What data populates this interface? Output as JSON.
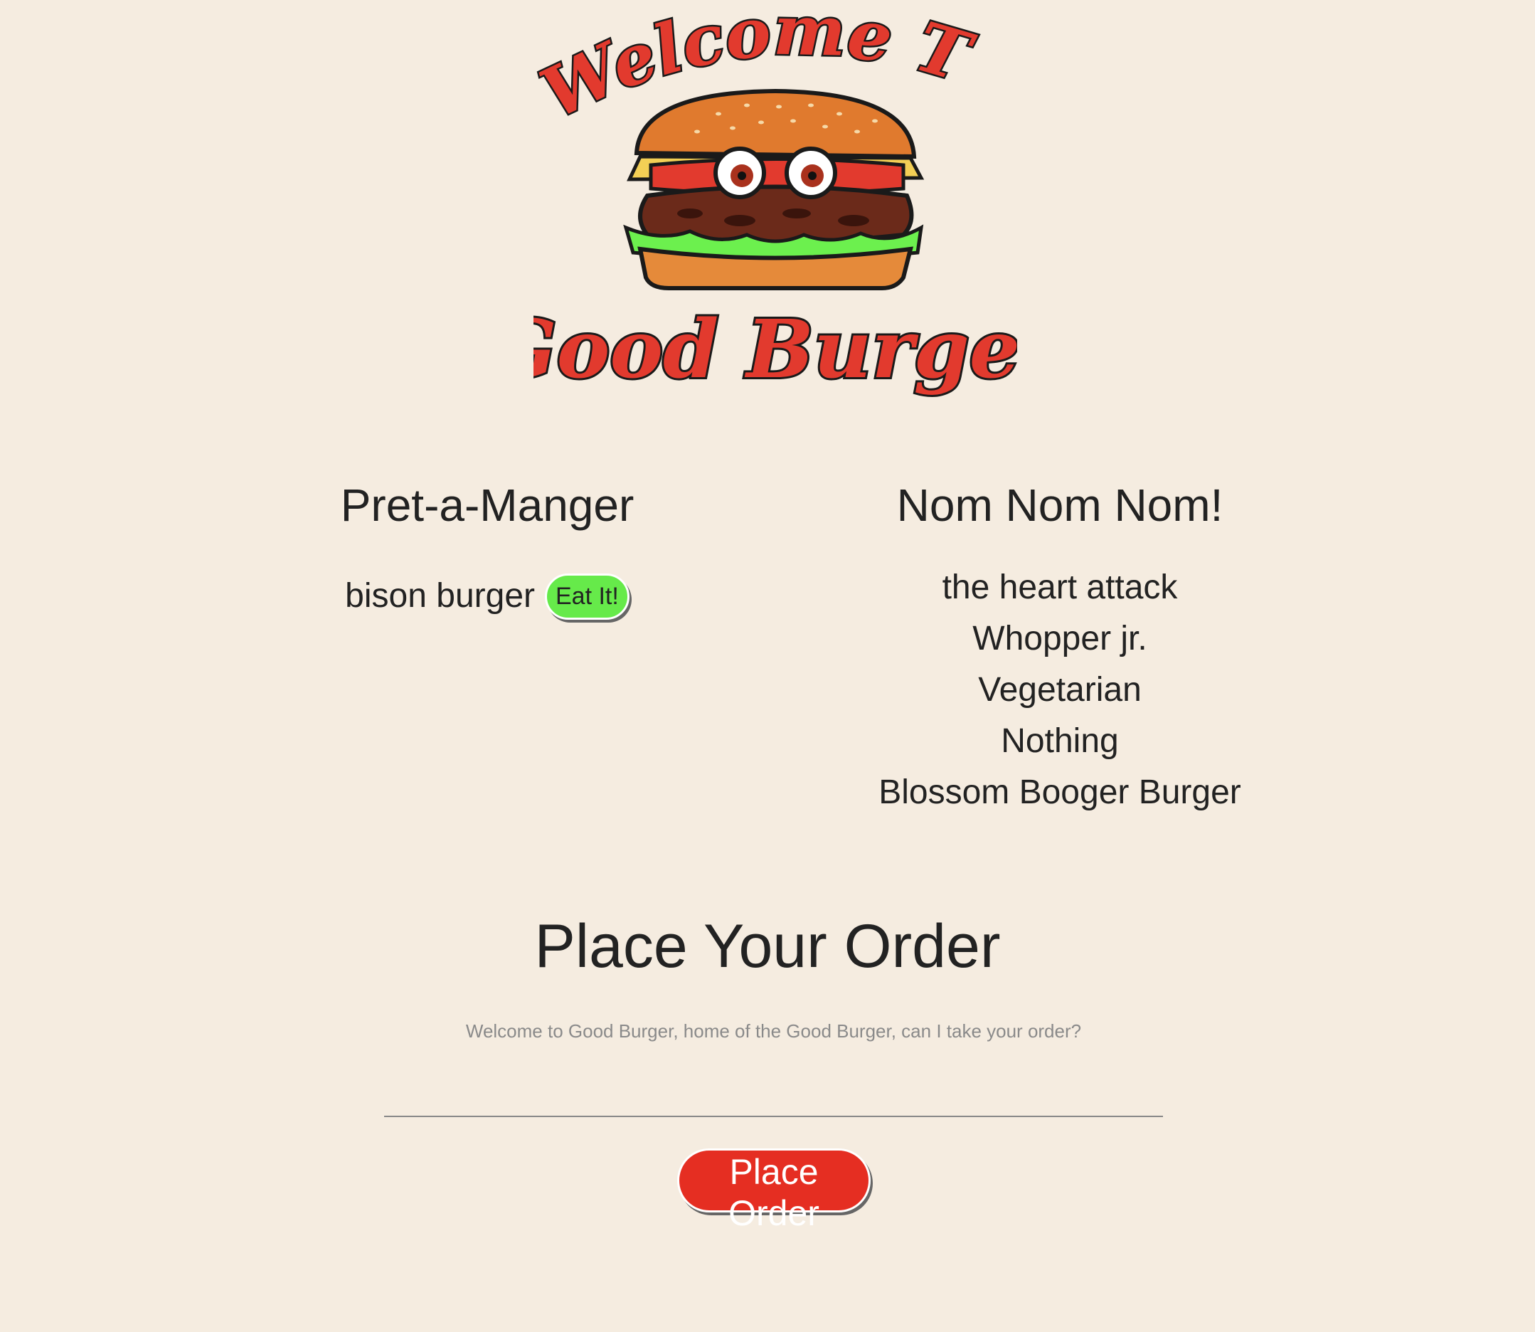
{
  "logo": {
    "top_text": "Welcome To",
    "bottom_text": "Good Burger"
  },
  "colors": {
    "background": "#f5ece0",
    "eat_button": "#66ea4a",
    "place_button": "#e52e22",
    "logo_red": "#e23a2e"
  },
  "uneaten": {
    "heading": "Pret-a-Manger",
    "items": [
      {
        "name": "bison burger",
        "button_label": "Eat It!"
      }
    ]
  },
  "devoured": {
    "heading": "Nom Nom Nom!",
    "items": [
      "the heart attack",
      "Whopper jr.",
      "Vegetarian",
      "Nothing",
      "Blossom Booger Burger"
    ]
  },
  "order": {
    "title": "Place Your Order",
    "input_placeholder": "Welcome to Good Burger, home of the Good Burger, can I take your order?",
    "input_value": "",
    "button_label": "Place Order"
  }
}
